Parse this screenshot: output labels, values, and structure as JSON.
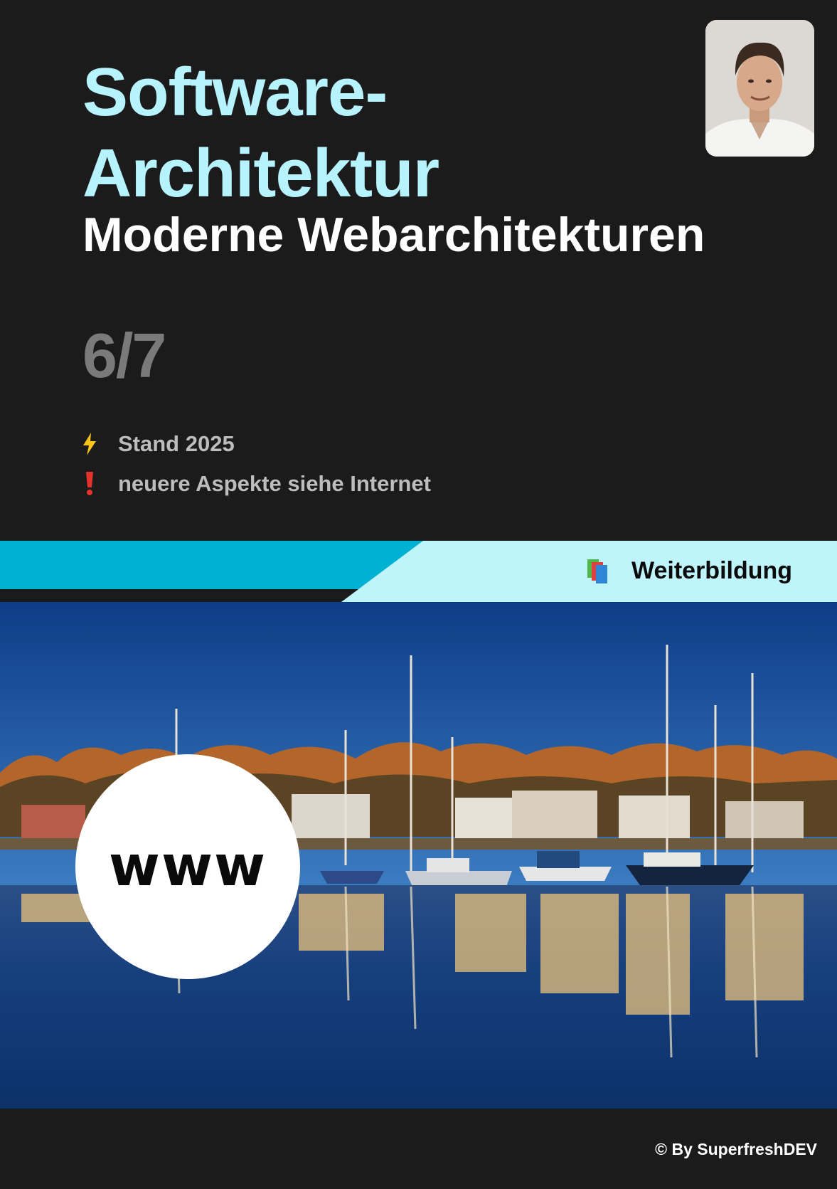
{
  "header": {
    "title_line1": "Software-",
    "title_line2": "Architektur",
    "subtitle": "Moderne Webarchitekturen",
    "counter": "6/7"
  },
  "info": [
    {
      "icon": "lightning-icon",
      "text": "Stand 2025"
    },
    {
      "icon": "exclamation-icon",
      "text": "neuere Aspekte siehe Internet"
    }
  ],
  "banner": {
    "icon": "books-icon",
    "label": "Weiterbildung"
  },
  "badge": {
    "text": "www"
  },
  "footer": {
    "copyright": "© By SuperfreshDEV"
  },
  "colors": {
    "background": "#1b1b1b",
    "title": "#b6f3fc",
    "banner_dark": "#00b1d4",
    "banner_light": "#bff4fb"
  }
}
